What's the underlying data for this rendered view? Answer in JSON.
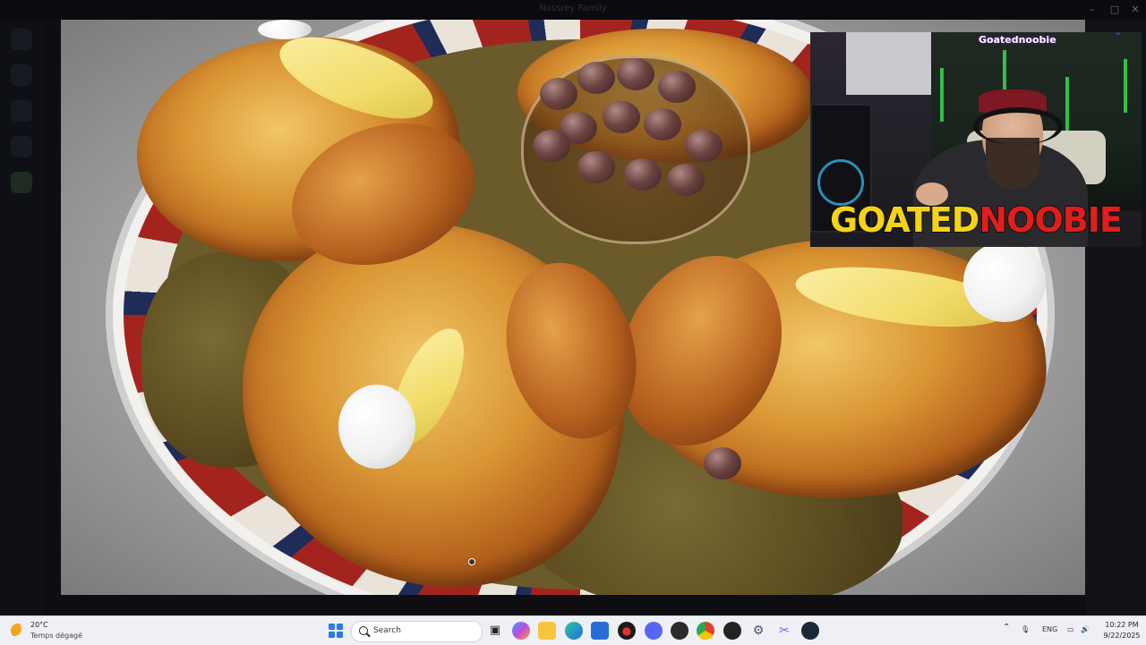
{
  "window": {
    "title": "Nossrey Family"
  },
  "overlay": {
    "handle": "Goatednoobie",
    "brand_part1": "GOATED",
    "brand_part2": "NOOBIE"
  },
  "taskbar": {
    "weather": {
      "temp": "20°C",
      "desc": "Temps dégagé",
      "icon": "moon-icon"
    },
    "search_placeholder": "Search",
    "apps": [
      "task-view",
      "copilot",
      "file-explorer",
      "edge",
      "store",
      "media-app",
      "discord",
      "app",
      "chrome",
      "steam-alt",
      "settings",
      "snipping-tool",
      "steam"
    ],
    "language": "ENG",
    "time": "10:22 PM",
    "date": "9/22/2025"
  },
  "colors": {
    "brand_yellow": "#f4d318",
    "brand_red": "#e01e1e",
    "taskbar_bg": "#eef0f5",
    "accent_blue": "#2a7ce8"
  }
}
